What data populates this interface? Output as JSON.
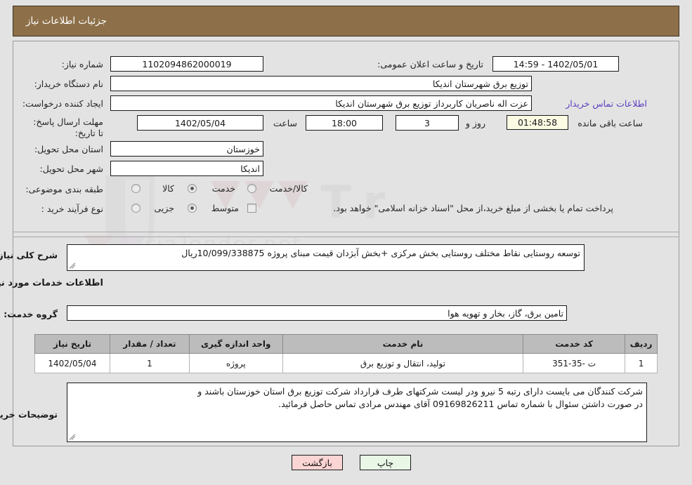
{
  "header": {
    "title": "جزئیات اطلاعات نیاز"
  },
  "form": {
    "need_number_label": "شماره نیاز:",
    "need_number_value": "1102094862000019",
    "announce_datetime_label": "تاریخ و ساعت اعلان عمومی:",
    "announce_datetime_value": "1402/05/01 - 14:59",
    "buyer_org_label": "نام دستگاه خریدار:",
    "buyer_org_value": "توزیع برق شهرستان اندیکا",
    "requester_label": "ایجاد کننده درخواست:",
    "requester_value": "عزت اله ناصریان کاربرداز توزیع برق شهرستان اندیکا",
    "buyer_contact_link": "اطلاعات تماس خریدار",
    "deadline_label": "مهلت ارسال پاسخ: تا تاریخ:",
    "deadline_date_value": "1402/05/04",
    "hour_label": "ساعت",
    "hour_value": "18:00",
    "days_value": "3",
    "days_and_label": "روز و",
    "countdown_value": "01:48:58",
    "remaining_label": "ساعت باقی مانده",
    "province_label": "استان محل تحویل:",
    "province_value": "خوزستان",
    "city_label": "شهر محل تحویل:",
    "city_value": "اندیکا",
    "category_label": "طبقه بندی موضوعی:",
    "category_options": [
      {
        "label": "کالا",
        "selected": false
      },
      {
        "label": "خدمت",
        "selected": true
      },
      {
        "label": "کالا/خدمت",
        "selected": false
      }
    ],
    "process_label": "نوع فرآیند خرید :",
    "process_options": [
      {
        "label": "جزیی",
        "selected": false
      },
      {
        "label": "متوسط",
        "selected": true
      }
    ],
    "treasury_checkbox_checked": false,
    "treasury_note": "پرداخت تمام یا بخشی از مبلغ خرید،از محل \"اسناد خزانه اسلامی\" خواهد بود."
  },
  "description": {
    "label": "شرح کلی نیاز:",
    "value": "توسعه روستایی نقاط مختلف روستایی بخش مرکزی +بخش آبژدان قیمت مبنای پروژه 10/099/338875ریال"
  },
  "services_section": {
    "heading": "اطلاعات خدمات مورد نیاز",
    "group_label": "گروه خدمت:",
    "group_value": "تامین برق، گاز، بخار و تهویه هوا"
  },
  "table": {
    "columns": [
      "ردیف",
      "کد خدمت",
      "نام خدمت",
      "واحد اندازه گیری",
      "تعداد / مقدار",
      "تاریخ نیاز"
    ],
    "rows": [
      {
        "row_no": "1",
        "service_code": "ت -35-351",
        "service_name": "تولید، انتقال و توزیع برق",
        "unit": "پروژه",
        "quantity": "1",
        "need_date": "1402/05/04"
      }
    ]
  },
  "notes": {
    "label": "توضیحات خریدار:",
    "line1": "شرکت کنندگان می بایست دارای رتبه 5 نیرو  ودر لیست شرکتهای طرف قرارداد شرکت توزیع برق استان خوزستان باشند و",
    "line2": "در صورت داشتن سئوال با شماره تماس 09169826211 آقای مهندس مرادی تماس حاصل فرمائید."
  },
  "footer": {
    "print_label": "چاپ",
    "back_label": "بازگشت"
  },
  "colors": {
    "header_bg": "#8d7049",
    "page_bg": "#e3e3e3",
    "link": "#5b3fbf",
    "countdown_bg": "#fbfbe4",
    "print_bg": "#e9f7e6",
    "back_bg": "#fbd4d4",
    "table_header_bg": "#bcbcbc"
  },
  "watermark": {
    "text": "AriaTender.net"
  }
}
